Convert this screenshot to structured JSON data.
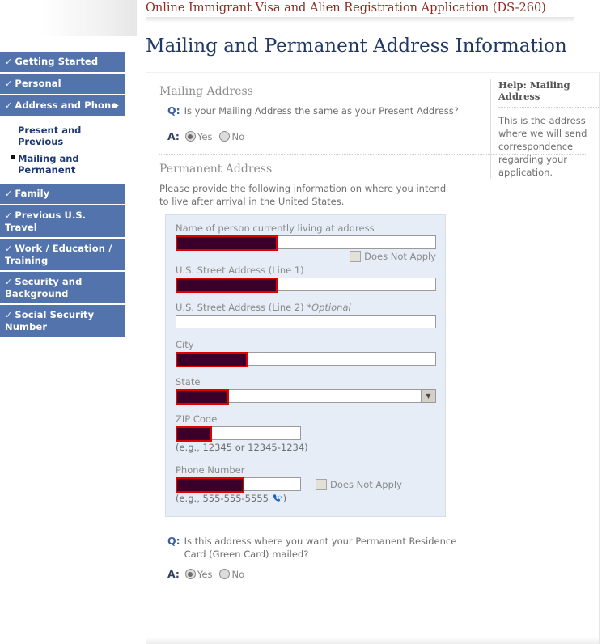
{
  "app": {
    "title": "Online Immigrant Visa and Alien Registration Application (DS-260)",
    "page_title": "Mailing and Permanent Address Information"
  },
  "colors": {
    "nav_blue": "#5273ab",
    "title_red": "#8c2a1f",
    "heading_navy": "#1f3864",
    "panel_blue": "#e6edf6",
    "redaction_fill": "#3a0029",
    "redaction_border": "#e00000"
  },
  "sidebar": {
    "main_items": [
      {
        "label": "Getting Started",
        "check": "✓",
        "arrow": ""
      },
      {
        "label": "Personal",
        "check": "✓",
        "arrow": ""
      },
      {
        "label": "Address and Phone",
        "check": "✓",
        "arrow": "▶"
      }
    ],
    "sub_items": [
      {
        "label": "Present and Previous",
        "current": false
      },
      {
        "label": "Mailing and Permanent",
        "current": true
      }
    ],
    "main_items_after": [
      {
        "label": "Family",
        "check": "✓",
        "arrow": ""
      },
      {
        "label": "Previous U.S. Travel",
        "check": "✓",
        "arrow": ""
      },
      {
        "label": "Work / Education / Training",
        "check": "✓",
        "arrow": ""
      },
      {
        "label": "Security and Background",
        "check": "✓",
        "arrow": ""
      },
      {
        "label": "Social Security Number",
        "check": "✓",
        "arrow": ""
      }
    ]
  },
  "mailing_section": {
    "heading": "Mailing Address",
    "q_marker": "Q:",
    "question": "Is your Mailing Address the same as your Present Address?",
    "a_marker": "A:",
    "yes_label": "Yes",
    "no_label": "No",
    "selected": "Yes"
  },
  "help": {
    "title": "Help: Mailing Address",
    "body": "This is the address where we will send correspondence regarding your application."
  },
  "permanent_section": {
    "heading": "Permanent Address",
    "intro": "Please provide the following information on where you intend to live after arrival in the United States.",
    "fields": [
      {
        "label": "Name of person currently living at address",
        "type": "text",
        "value": "",
        "redacted": true,
        "redact_width": 126,
        "does_not_apply": true,
        "does_not_apply_label": "Does Not Apply",
        "does_not_apply_checked": false,
        "hint": ""
      },
      {
        "label": "U.S. Street Address (Line 1)",
        "type": "text",
        "value": "",
        "redacted": true,
        "redact_width": 126,
        "does_not_apply": false,
        "hint": ""
      },
      {
        "label": "U.S. Street Address (Line 2) ",
        "label_italic": "*Optional",
        "type": "text",
        "value": "",
        "redacted": false,
        "does_not_apply": false,
        "hint": ""
      },
      {
        "label": "City",
        "type": "text",
        "value": "",
        "redacted": true,
        "redact_width": 89,
        "does_not_apply": false,
        "hint": ""
      },
      {
        "label": "State",
        "type": "select",
        "value": "",
        "redacted": true,
        "redact_width": 66,
        "does_not_apply": false,
        "hint": ""
      },
      {
        "label": "ZIP Code",
        "type": "text-short",
        "value": "",
        "redacted": true,
        "redact_width": 45,
        "does_not_apply": false,
        "hint": "(e.g., 12345 or 12345-1234)"
      },
      {
        "label": "Phone Number",
        "type": "text-phone",
        "value": "",
        "redacted": true,
        "redact_width": 85,
        "does_not_apply": true,
        "does_not_apply_label": "Does Not Apply",
        "does_not_apply_checked": false,
        "hint_prefix": "(e.g., 555-555-5555 ",
        "hint_icon": "phone-call-icon",
        "hint_suffix": ")"
      }
    ]
  },
  "green_card_section": {
    "q_marker": "Q:",
    "question": "Is this address where you want your Permanent Residence Card (Green Card) mailed?",
    "a_marker": "A:",
    "yes_label": "Yes",
    "no_label": "No",
    "selected": "Yes"
  }
}
